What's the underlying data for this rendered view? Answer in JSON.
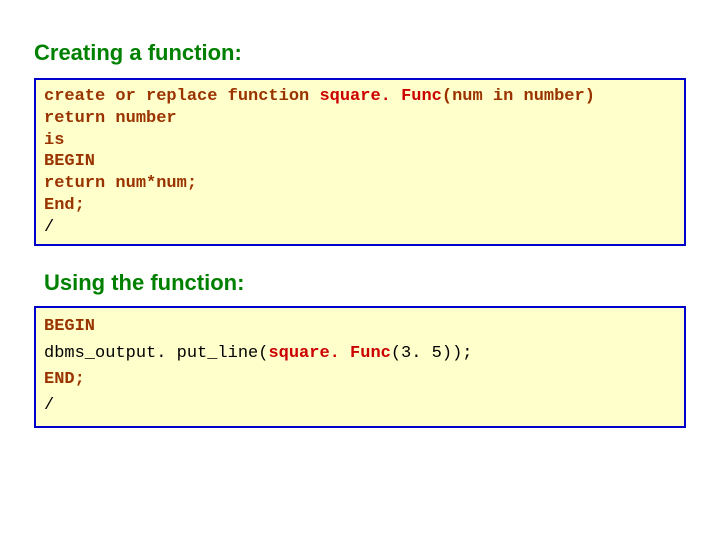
{
  "heading1": "Creating a function:",
  "code1": {
    "l1a": "create or replace function ",
    "l1b": "square. Func",
    "l1c": "(num in number)",
    "l2": "return number",
    "l3": "is",
    "l4": "BEGIN",
    "l5": "return num*num;",
    "l6": "End;",
    "l7": "/"
  },
  "heading2": "Using the function:",
  "code2": {
    "l1": "BEGIN",
    "l2a": "dbms_output. put_line(",
    "l2b": "square. Func",
    "l2c": "(3. 5));",
    "l3": "END;",
    "l4": "/"
  }
}
